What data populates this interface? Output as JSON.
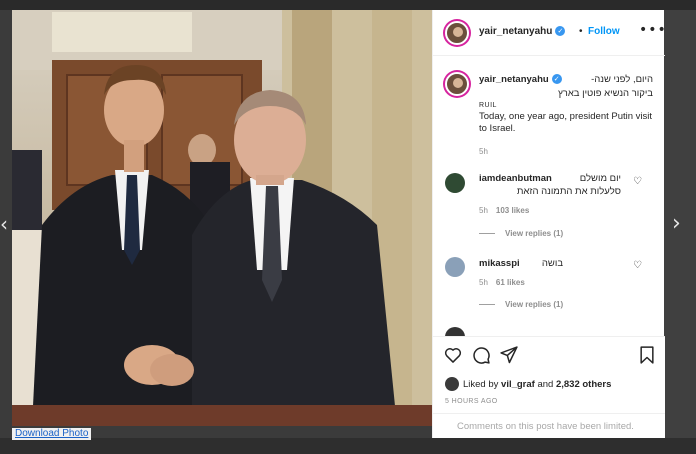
{
  "page": {
    "download_label": "Download Photo"
  },
  "post": {
    "username": "yair_netanyahu",
    "follow_label": "Follow",
    "separator": "•",
    "more_icon": "more-horizontal-icon"
  },
  "caption": {
    "username": "yair_netanyahu",
    "hebrew_line1": "היום, לפני שנה-",
    "hebrew_line2": "ביקור הנשיא פוטין בארץ",
    "tag": "RUIL",
    "english": "Today, one year ago, president Putin visit to Israel.",
    "time": "5h"
  },
  "comments": [
    {
      "username": "iamdeanbutman",
      "text_line1": "יום מושלם",
      "text_line2": "סלעלות את התמונה הזאת",
      "time": "5h",
      "likes": "103 likes",
      "replies": "View replies (1)"
    },
    {
      "username": "mikasspi",
      "text_line1": "בושה",
      "time": "5h",
      "likes": "61 likes",
      "replies": "View replies (1)"
    }
  ],
  "actions": {
    "liked_prefix": "Liked by ",
    "liked_user": "vil_graf",
    "liked_mid": " and ",
    "liked_count": "2,832 others",
    "ago": "5 HOURS AGO",
    "limited": "Comments on this post have been limited."
  },
  "colors": {
    "link": "#0095f6",
    "verified": "#3897f0",
    "story_ring": "#d6249f"
  }
}
